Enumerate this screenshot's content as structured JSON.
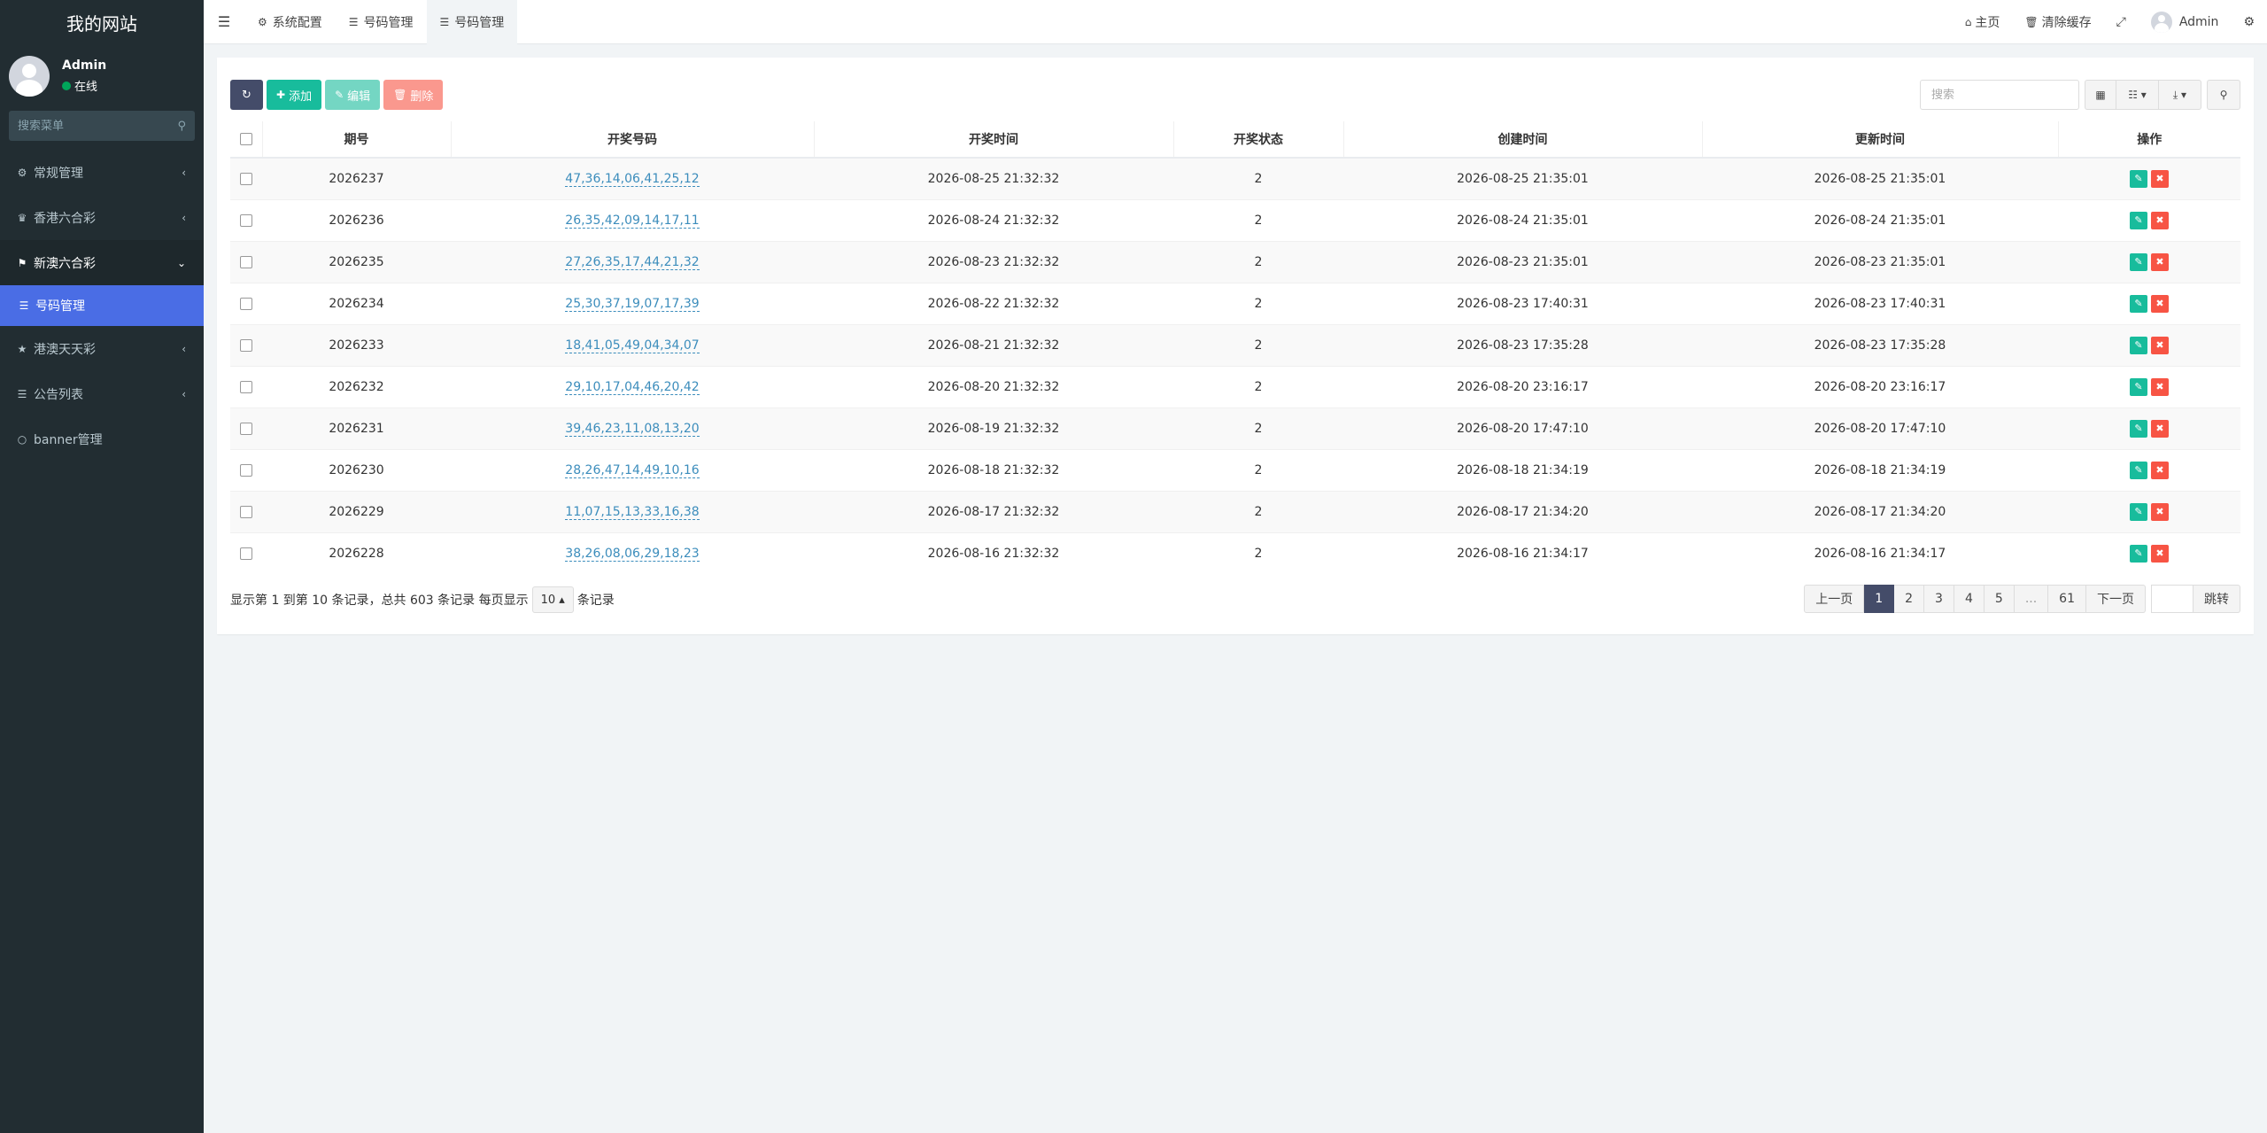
{
  "sidebar": {
    "brand": "我的网站",
    "user": {
      "name": "Admin",
      "status": "在线"
    },
    "search_placeholder": "搜索菜单",
    "items": [
      {
        "label": "常规管理",
        "icon": "cogs-icon"
      },
      {
        "label": "香港六合彩",
        "icon": "trophy-icon"
      },
      {
        "label": "新澳六合彩",
        "icon": "flag-icon"
      },
      {
        "label": "号码管理",
        "icon": "list-icon"
      },
      {
        "label": "港澳天天彩",
        "icon": "star-icon"
      },
      {
        "label": "公告列表",
        "icon": "list-icon"
      },
      {
        "label": "banner管理",
        "icon": "circle-icon"
      }
    ]
  },
  "topnav": {
    "tabs": [
      {
        "label": "系统配置"
      },
      {
        "label": "号码管理"
      },
      {
        "label": "号码管理"
      }
    ],
    "home": "主页",
    "clear_cache": "清除缓存",
    "admin": "Admin"
  },
  "toolbar": {
    "add": "添加",
    "edit": "编辑",
    "delete": "删除",
    "search_placeholder": "搜索"
  },
  "table": {
    "headers": [
      "期号",
      "开奖号码",
      "开奖时间",
      "开奖状态",
      "创建时间",
      "更新时间",
      "操作"
    ],
    "rows": [
      {
        "issue": "2026237",
        "numbers": "47,36,14,06,41,25,12",
        "draw_time": "2026-08-25 21:32:32",
        "status": "2",
        "created": "2026-08-25 21:35:01",
        "updated": "2026-08-25 21:35:01"
      },
      {
        "issue": "2026236",
        "numbers": "26,35,42,09,14,17,11",
        "draw_time": "2026-08-24 21:32:32",
        "status": "2",
        "created": "2026-08-24 21:35:01",
        "updated": "2026-08-24 21:35:01"
      },
      {
        "issue": "2026235",
        "numbers": "27,26,35,17,44,21,32",
        "draw_time": "2026-08-23 21:32:32",
        "status": "2",
        "created": "2026-08-23 21:35:01",
        "updated": "2026-08-23 21:35:01"
      },
      {
        "issue": "2026234",
        "numbers": "25,30,37,19,07,17,39",
        "draw_time": "2026-08-22 21:32:32",
        "status": "2",
        "created": "2026-08-23 17:40:31",
        "updated": "2026-08-23 17:40:31"
      },
      {
        "issue": "2026233",
        "numbers": "18,41,05,49,04,34,07",
        "draw_time": "2026-08-21 21:32:32",
        "status": "2",
        "created": "2026-08-23 17:35:28",
        "updated": "2026-08-23 17:35:28"
      },
      {
        "issue": "2026232",
        "numbers": "29,10,17,04,46,20,42",
        "draw_time": "2026-08-20 21:32:32",
        "status": "2",
        "created": "2026-08-20 23:16:17",
        "updated": "2026-08-20 23:16:17"
      },
      {
        "issue": "2026231",
        "numbers": "39,46,23,11,08,13,20",
        "draw_time": "2026-08-19 21:32:32",
        "status": "2",
        "created": "2026-08-20 17:47:10",
        "updated": "2026-08-20 17:47:10"
      },
      {
        "issue": "2026230",
        "numbers": "28,26,47,14,49,10,16",
        "draw_time": "2026-08-18 21:32:32",
        "status": "2",
        "created": "2026-08-18 21:34:19",
        "updated": "2026-08-18 21:34:19"
      },
      {
        "issue": "2026229",
        "numbers": "11,07,15,13,33,16,38",
        "draw_time": "2026-08-17 21:32:32",
        "status": "2",
        "created": "2026-08-17 21:34:20",
        "updated": "2026-08-17 21:34:20"
      },
      {
        "issue": "2026228",
        "numbers": "38,26,08,06,29,18,23",
        "draw_time": "2026-08-16 21:32:32",
        "status": "2",
        "created": "2026-08-16 21:34:17",
        "updated": "2026-08-16 21:34:17"
      }
    ]
  },
  "footer": {
    "info_prefix": "显示第 1 到第 10 条记录，总共 603 条记录 每页显示",
    "page_size": "10",
    "info_suffix": "条记录"
  },
  "pagination": {
    "prev": "上一页",
    "pages": [
      "1",
      "2",
      "3",
      "4",
      "5",
      "...",
      "61"
    ],
    "current": "1",
    "next": "下一页",
    "jump": "跳转"
  }
}
